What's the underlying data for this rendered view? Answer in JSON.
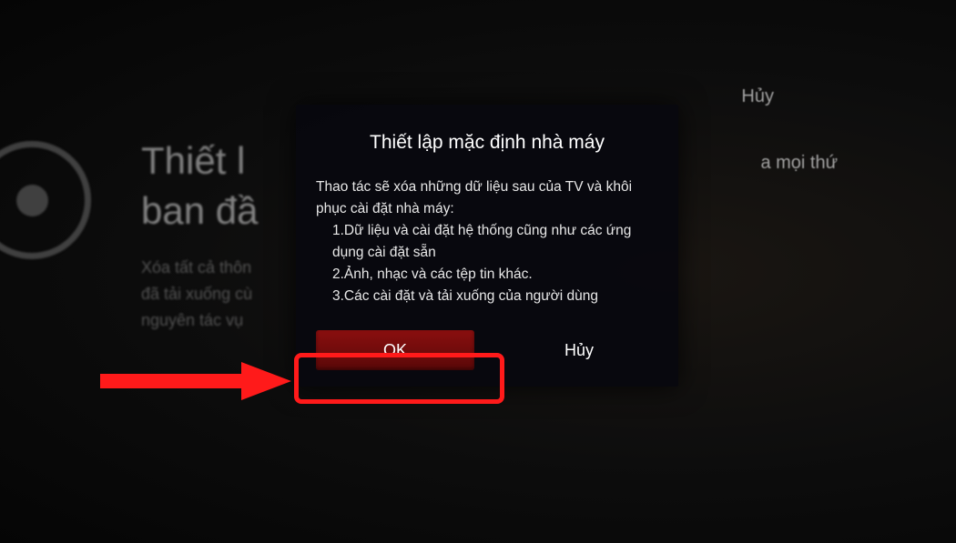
{
  "background": {
    "title_line1": "Thiết l",
    "title_line2": "ban đầ",
    "desc_line1": "Xóa tất cả thôn",
    "desc_line2": "đã tải xuống cù",
    "desc_line3": "nguyên tác vụ",
    "right_cancel": "Hủy",
    "right_partial": "a mọi thứ"
  },
  "dialog": {
    "title": "Thiết lập mặc định nhà máy",
    "intro": "Thao tác sẽ xóa những dữ liệu sau của TV và khôi phục cài đặt nhà máy:",
    "item1": "1.Dữ liệu và cài đặt hệ thống cũng như các ứng dụng cài đặt sẵn",
    "item2": "2.Ảnh, nhạc và các tệp tin khác.",
    "item3": "3.Các cài đặt và tải xuống của người dùng",
    "ok_label": "OK",
    "cancel_label": "Hủy"
  },
  "annotation": {
    "arrow_color": "#ff1a1a",
    "highlight_color": "#ff1a1a"
  }
}
